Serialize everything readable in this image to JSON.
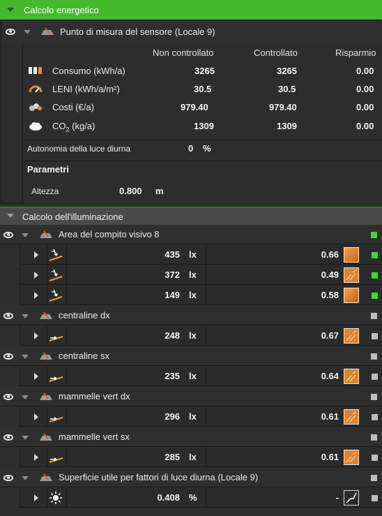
{
  "energy_section": {
    "title": "Calcolo energetico",
    "group_label": "Punto di misura del sensore (Locale 9)",
    "columns": [
      "Non controllato",
      "Controllato",
      "Risparmio"
    ],
    "rows": [
      {
        "icon": "consumption-icon",
        "label": "Consumo (kWh/a)",
        "uncontrolled": "3265",
        "controlled": "3265",
        "saving": "0.00"
      },
      {
        "icon": "leni-gauge-icon",
        "label": "LENI (kWh/a/m²)",
        "uncontrolled": "30.5",
        "controlled": "30.5",
        "saving": "0.00"
      },
      {
        "icon": "cost-icon",
        "label": "Costi (€/a)",
        "uncontrolled": "979.40",
        "controlled": "979.40",
        "saving": "0.00"
      },
      {
        "icon": "co2-cloud-icon",
        "label_main": "CO",
        "label_sub": "2",
        "label_unit": "(kg/a)",
        "uncontrolled": "1309",
        "controlled": "1309",
        "saving": "0.00"
      }
    ],
    "daylight_autonomy": {
      "label": "Autonomia della luce diurna",
      "value": "0",
      "unit": "%"
    },
    "params_title": "Parametri",
    "height": {
      "label": "Altezza",
      "value": "0.800",
      "unit": "m"
    }
  },
  "lighting_section": {
    "title": "Calcolo dell'illuminazione",
    "groups": [
      {
        "label": "Area del compito visivo 8",
        "status_color": "#43d83a",
        "results": [
          {
            "value": "435",
            "unit": "lx",
            "ratio": "0.66",
            "swatch": "solid",
            "status_color": "#43d83a",
            "icon": "task-area-icon"
          },
          {
            "value": "372",
            "unit": "lx",
            "ratio": "0.49",
            "swatch": "hatch",
            "status_color": "#43d83a",
            "icon": "task-area-icon"
          },
          {
            "value": "149",
            "unit": "lx",
            "ratio": "0.58",
            "swatch": "solid",
            "status_color": "#43d83a",
            "icon": "task-area-icon"
          }
        ]
      },
      {
        "label": "centraline dx",
        "status_color": "#bdbdbd",
        "results": [
          {
            "value": "248",
            "unit": "lx",
            "ratio": "0.67",
            "swatch": "hatch",
            "status_color": "#bdbdbd",
            "icon": "calc-surface-icon"
          }
        ]
      },
      {
        "label": "centraline sx",
        "status_color": "#bdbdbd",
        "results": [
          {
            "value": "235",
            "unit": "lx",
            "ratio": "0.64",
            "swatch": "hatch",
            "status_color": "#bdbdbd",
            "icon": "calc-surface-icon"
          }
        ]
      },
      {
        "label": "mammelle vert dx",
        "status_color": "#bdbdbd",
        "results": [
          {
            "value": "296",
            "unit": "lx",
            "ratio": "0.61",
            "swatch": "hatch",
            "status_color": "#bdbdbd",
            "icon": "calc-surface-icon"
          }
        ]
      },
      {
        "label": "mammelle vert sx",
        "status_color": "#bdbdbd",
        "results": [
          {
            "value": "285",
            "unit": "lx",
            "ratio": "0.61",
            "swatch": "hatch",
            "status_color": "#bdbdbd",
            "icon": "calc-surface-icon"
          }
        ]
      },
      {
        "label": "Superficie utile per fattori di luce diurna (Locale 9)",
        "status_color": "#bdbdbd",
        "results": [
          {
            "value": "0.408",
            "unit": "%",
            "ratio": "-",
            "swatch": "daylight",
            "status_color": "#bdbdbd",
            "icon": "sun-icon"
          }
        ]
      }
    ]
  },
  "colors": {
    "accent_green": "#45b82b",
    "status_green": "#43d83a",
    "status_gray": "#bdbdbd",
    "swatch_orange": "#d98533"
  }
}
